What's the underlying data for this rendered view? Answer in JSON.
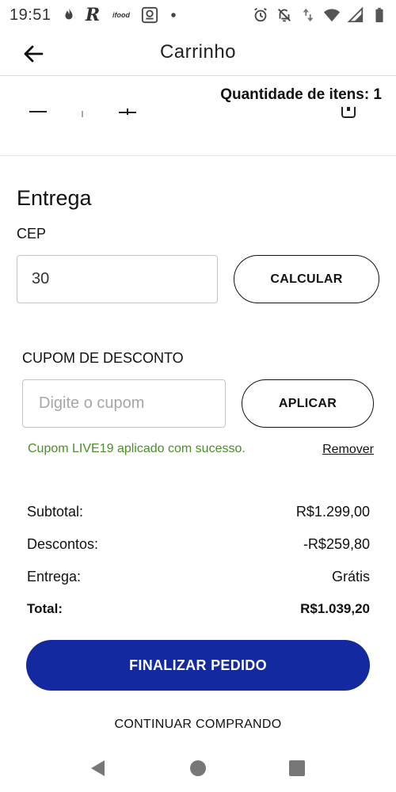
{
  "status_bar": {
    "time": "19:51",
    "left_icons": [
      "flame-icon",
      "r-app-icon",
      "ifood-icon",
      "app-box-icon",
      "dot-icon"
    ],
    "ifood_label": "ifood",
    "r_label": "R",
    "right_icons": [
      "alarm-icon",
      "bell-off-icon",
      "data-arrows-icon",
      "wifi-icon",
      "signal-icon",
      "battery-icon"
    ]
  },
  "app_bar": {
    "title": "Carrinho",
    "back_icon": "arrow-left-icon"
  },
  "product": {
    "items_count_text": "Quantidade de itens: 1"
  },
  "delivery": {
    "title": "Entrega",
    "cep_label": "CEP",
    "cep_value": "30",
    "calculate_label": "CALCULAR"
  },
  "coupon": {
    "label": "CUPOM DE DESCONTO",
    "placeholder": "Digite o cupom",
    "apply_label": "APLICAR",
    "success_message": "Cupom LIVE19 aplicado com sucesso.",
    "remove_label": "Remover",
    "success_color": "#4a8f29"
  },
  "summary": {
    "subtotal_label": "Subtotal:",
    "subtotal_value": "R$1.299,00",
    "discounts_label": "Descontos:",
    "discounts_value": "-R$259,80",
    "delivery_label": "Entrega:",
    "delivery_value": "Grátis",
    "total_label": "Total:",
    "total_value": "R$1.039,20"
  },
  "actions": {
    "finish_label": "FINALIZAR PEDIDO",
    "continue_label": "CONTINUAR COMPRANDO",
    "primary_color": "#1428a0"
  },
  "nav_bar": {
    "icons": [
      "nav-back-icon",
      "nav-home-icon",
      "nav-recents-icon"
    ]
  }
}
